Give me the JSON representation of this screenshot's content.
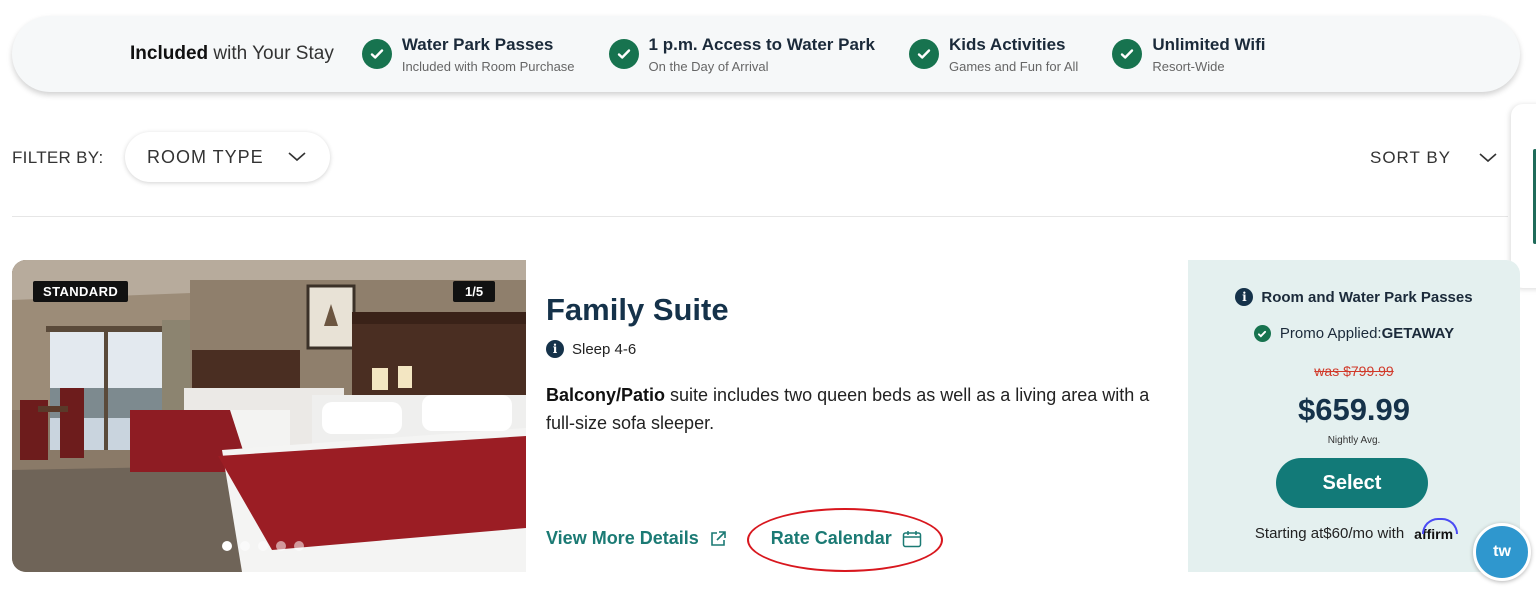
{
  "banner": {
    "lead_bold": "Included",
    "lead_rest": " with Your Stay",
    "perks": [
      {
        "title": "Water Park Passes",
        "subtitle": "Included with Room Purchase"
      },
      {
        "title": "1 p.m. Access to Water Park",
        "subtitle": "On the Day of Arrival"
      },
      {
        "title": "Kids Activities",
        "subtitle": "Games and Fun for All"
      },
      {
        "title": "Unlimited Wifi",
        "subtitle": "Resort-Wide"
      }
    ]
  },
  "filters": {
    "label": "FILTER BY:",
    "room_type": "ROOM TYPE",
    "sort_by": "SORT BY"
  },
  "room": {
    "badge": "STANDARD",
    "photo_counter": "1/5",
    "photo_dots_active": 1,
    "photo_dots_total": 5,
    "name": "Family Suite",
    "sleeps": "Sleep 4-6",
    "desc_bold": "Balcony/Patio",
    "desc_rest": " suite includes two queen beds as well as a living area with a full-size sofa sleeper.",
    "view_details": "View More Details",
    "rate_calendar": "Rate Calendar"
  },
  "pricing": {
    "package": "Room and Water Park Passes",
    "promo_label": "Promo Applied: ",
    "promo_code": "GETAWAY",
    "was_price": "was $799.99",
    "price": "$659.99",
    "price_note": "Nightly Avg.",
    "select_label": "Select",
    "financing": "Starting at$60/mo with",
    "affirm_logo": "affirm"
  },
  "chat": {
    "label": "tw"
  },
  "colors": {
    "check_green": "#17734f",
    "teal_link": "#1b7a74",
    "select_button": "#127a78",
    "navy_text": "#15324a",
    "pricing_bg": "#e4f0ef",
    "annotation_red": "#d8171e"
  }
}
